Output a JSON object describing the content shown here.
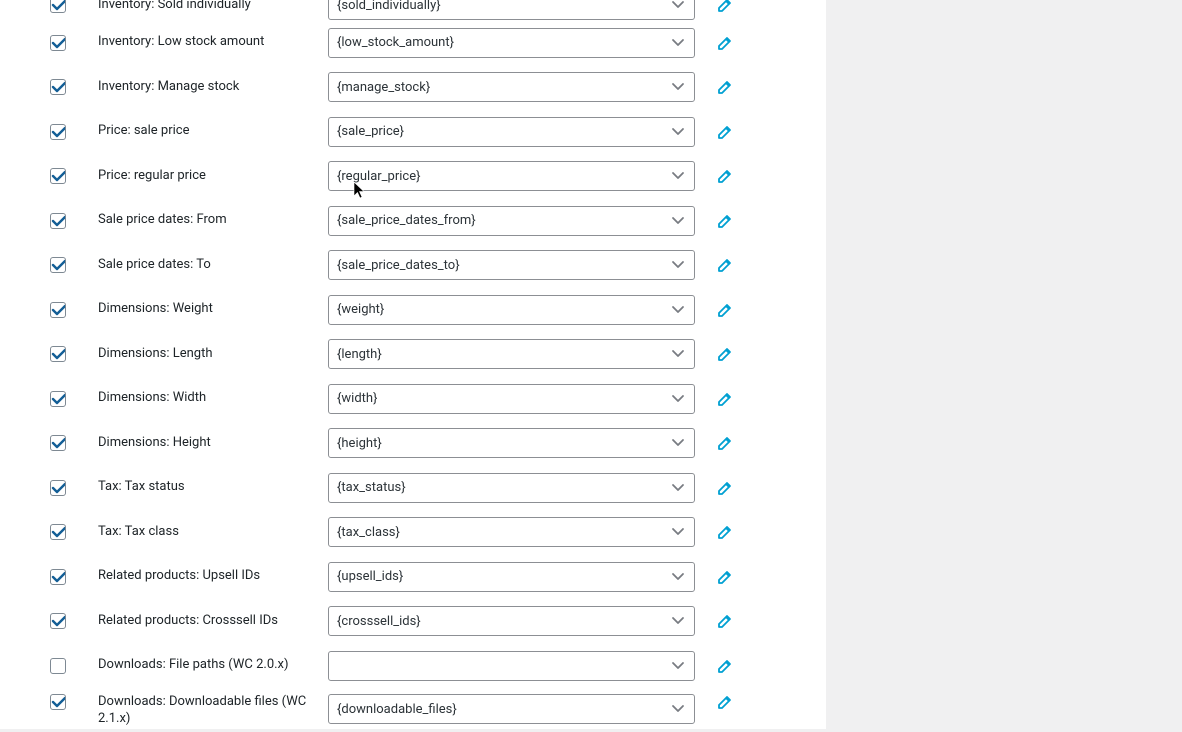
{
  "fields": [
    {
      "label": "Inventory: Sold individually",
      "value": "{sold_individually}",
      "checked": true
    },
    {
      "label": "Inventory: Low stock amount",
      "value": "{low_stock_amount}",
      "checked": true
    },
    {
      "label": "Inventory: Manage stock",
      "value": "{manage_stock}",
      "checked": true
    },
    {
      "label": "Price: sale price",
      "value": "{sale_price}",
      "checked": true
    },
    {
      "label": "Price: regular price",
      "value": "{regular_price}",
      "checked": true
    },
    {
      "label": "Sale price dates: From",
      "value": "{sale_price_dates_from}",
      "checked": true
    },
    {
      "label": "Sale price dates: To",
      "value": "{sale_price_dates_to}",
      "checked": true
    },
    {
      "label": "Dimensions: Weight",
      "value": "{weight}",
      "checked": true
    },
    {
      "label": "Dimensions: Length",
      "value": "{length}",
      "checked": true
    },
    {
      "label": "Dimensions: Width",
      "value": "{width}",
      "checked": true
    },
    {
      "label": "Dimensions: Height",
      "value": "{height}",
      "checked": true
    },
    {
      "label": "Tax: Tax status",
      "value": "{tax_status}",
      "checked": true
    },
    {
      "label": "Tax: Tax class",
      "value": "{tax_class}",
      "checked": true
    },
    {
      "label": "Related products: Upsell IDs",
      "value": "{upsell_ids}",
      "checked": true
    },
    {
      "label": "Related products: Crosssell IDs",
      "value": "{crosssell_ids}",
      "checked": true
    },
    {
      "label": "Downloads: File paths (WC 2.0.x)",
      "value": "",
      "checked": false
    },
    {
      "label": "Downloads: Downloadable files (WC 2.1.x)",
      "value": "{downloadable_files}",
      "checked": true
    }
  ],
  "colors": {
    "accent": "#00a0d2",
    "check": "#135e96",
    "border": "#8c8f94"
  }
}
